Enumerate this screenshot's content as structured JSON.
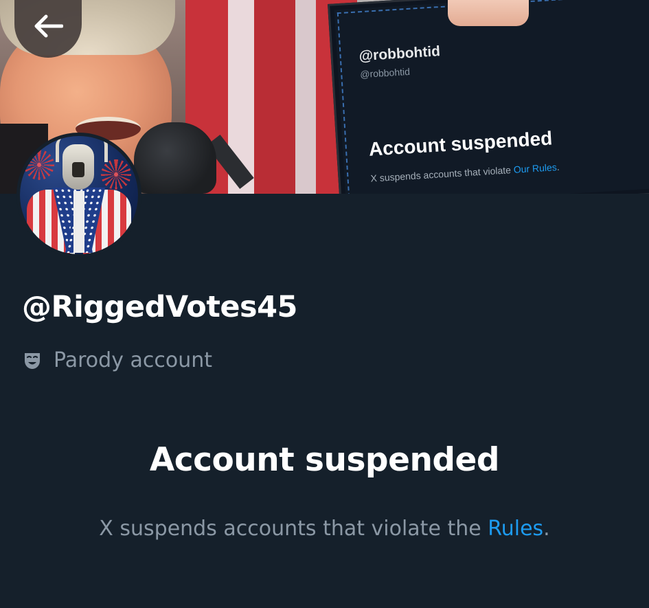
{
  "header": {
    "back_button_label": "Back"
  },
  "banner": {
    "card": {
      "handle": "@robbohtid",
      "sub_handle": "@robbohtid",
      "title": "Account suspended",
      "text_prefix": "X suspends accounts that violate ",
      "text_link": "Our Rules",
      "text_suffix": "."
    }
  },
  "profile": {
    "username": "@RiggedVotes45",
    "parody_label": "Parody account",
    "parody_icon": "theater-mask-icon"
  },
  "suspension": {
    "title": "Account suspended",
    "text_prefix": "X suspends accounts that violate the ",
    "rules_link": "Rules",
    "text_suffix": "."
  },
  "colors": {
    "background": "#15202b",
    "muted_text": "#8b98a5",
    "link": "#1d9bf0"
  }
}
